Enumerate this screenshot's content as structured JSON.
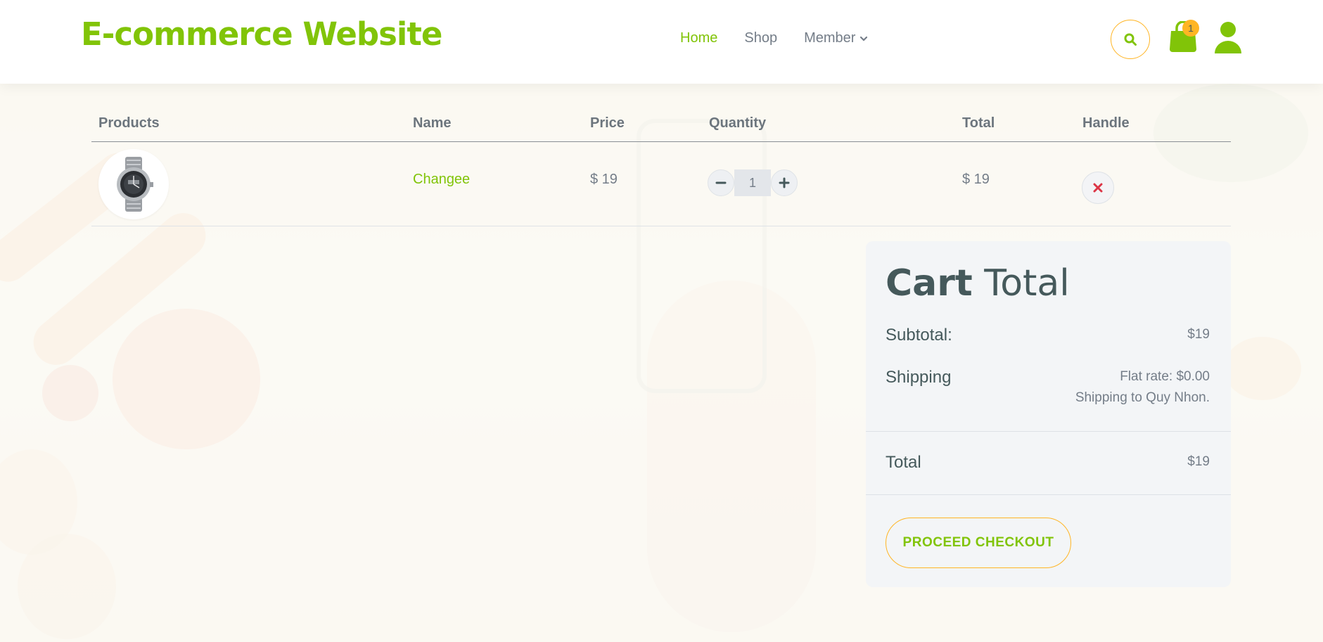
{
  "header": {
    "logo": "E-commerce Website",
    "nav": [
      {
        "label": "Home",
        "active": true
      },
      {
        "label": "Shop",
        "active": false
      },
      {
        "label": "Member",
        "active": false
      }
    ],
    "cart_count": "1"
  },
  "table": {
    "headers": [
      "Products",
      "Name",
      "Price",
      "Quantity",
      "Total",
      "Handle"
    ],
    "rows": [
      {
        "name": "Changee",
        "price": "$ 19",
        "quantity": "1",
        "total": "$ 19"
      }
    ]
  },
  "cart_total": {
    "title_bold": "Cart",
    "title_light": "Total",
    "subtotal_label": "Subtotal:",
    "subtotal_value": "$19",
    "shipping_label": "Shipping",
    "shipping_line1": "Flat rate: $0.00",
    "shipping_line2": "Shipping to Quy Nhon.",
    "total_label": "Total",
    "total_value": "$19",
    "checkout_label": "PROCEED CHECKOUT"
  },
  "colors": {
    "brand_green": "#81c408",
    "accent_orange": "#ffb524",
    "dark_text": "#45595b",
    "remove_red": "#dc3545"
  }
}
